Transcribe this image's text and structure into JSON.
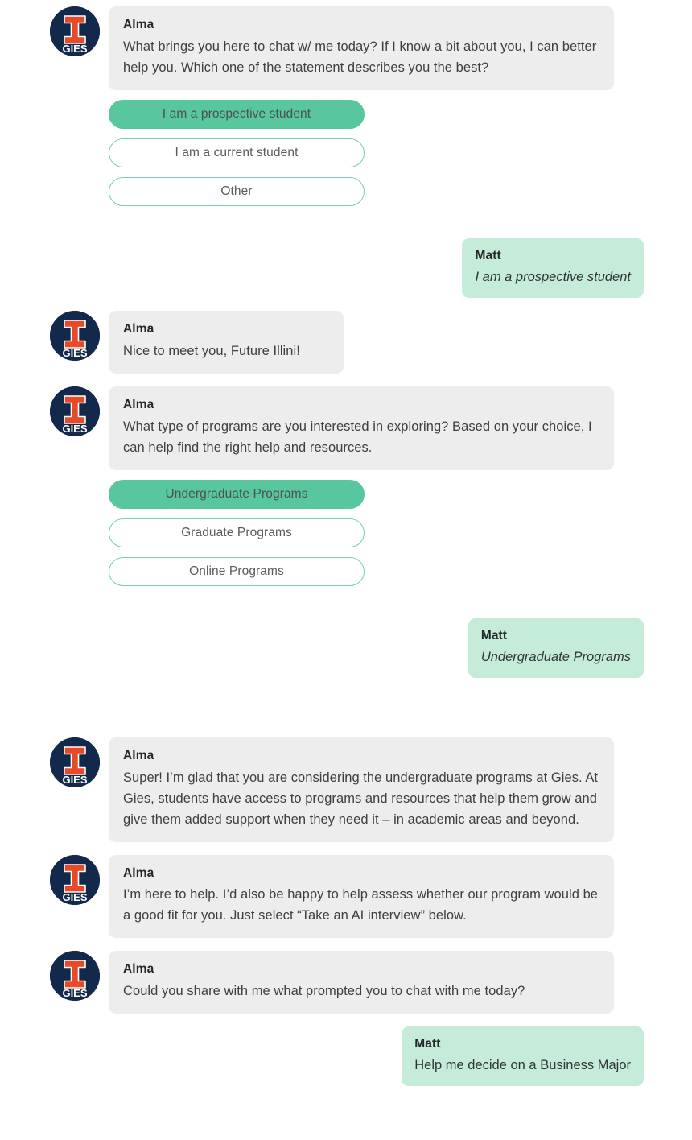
{
  "bot": {
    "name": "Alma",
    "avatar_icon": "gies-illinois-logo-icon",
    "avatar_letter": "I",
    "avatar_wordmark": "GIES"
  },
  "user": {
    "name": "Matt"
  },
  "colors": {
    "avatar_navy": "#13294B",
    "avatar_orange": "#E84A27",
    "bot_bubble": "#EDEDED",
    "user_bubble": "#C4ECD9",
    "option_selected": "#58C79E",
    "option_border": "#72CFAE"
  },
  "messages": {
    "m1": "What brings you here to chat w/ me today? If I know a bit about you, I can better help you. Which one of the statement describes you the best?",
    "m2": "Nice to meet you, Future Illini!",
    "m3": "What type of programs are you interested in exploring? Based on your choice, I can help find the right help and resources.",
    "m4": "Super! I’m glad that you are considering the undergraduate programs at Gies. At Gies, students have access to programs and resources that help them grow and give them added support when they need it – in academic areas and beyond.",
    "m5": "I’m here to help. I’d also be happy to help assess whether our program would be a good fit for you. Just select “Take an AI interview” below.",
    "m6": "Could you share with me what prompted you to chat with me today?"
  },
  "options_group_1": [
    {
      "label": "I am a prospective student",
      "selected": true
    },
    {
      "label": "I am a current student",
      "selected": false
    },
    {
      "label": "Other",
      "selected": false
    }
  ],
  "options_group_2": [
    {
      "label": "Undergraduate Programs",
      "selected": true
    },
    {
      "label": "Graduate Programs",
      "selected": false
    },
    {
      "label": "Online Programs",
      "selected": false
    }
  ],
  "user_replies": {
    "r1": "I am a prospective student",
    "r2": "Undergraduate Programs",
    "r3": "Help me decide on a Business Major"
  }
}
